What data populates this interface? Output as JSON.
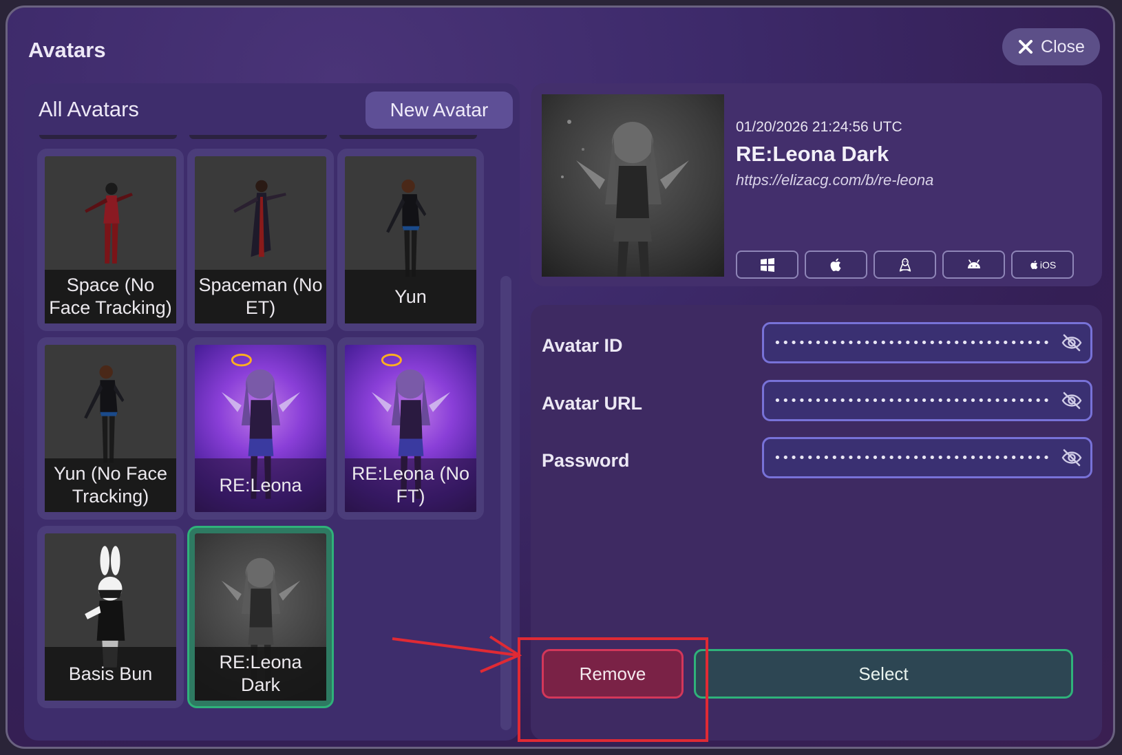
{
  "window": {
    "title": "Avatars",
    "close_label": "Close"
  },
  "left_panel": {
    "title": "All Avatars",
    "new_avatar_label": "New Avatar",
    "avatars": [
      {
        "name": "Space (No Face Tracking)",
        "style": "dark"
      },
      {
        "name": "Spaceman (No ET)",
        "style": "dark"
      },
      {
        "name": "Yun",
        "style": "dark"
      },
      {
        "name": "Yun (No Face Tracking)",
        "style": "dark"
      },
      {
        "name": "RE:Leona",
        "style": "purple"
      },
      {
        "name": "RE:Leona (No FT)",
        "style": "purple"
      },
      {
        "name": "Basis Bun",
        "style": "dark"
      },
      {
        "name": "RE:Leona Dark",
        "style": "gray",
        "selected": true
      }
    ]
  },
  "details": {
    "timestamp": "01/20/2026 21:24:56 UTC",
    "name": "RE:Leona Dark",
    "url": "https://elizacg.com/b/re-leona",
    "platforms": [
      {
        "icon": "windows-icon"
      },
      {
        "icon": "apple-icon"
      },
      {
        "icon": "linux-icon"
      },
      {
        "icon": "android-icon"
      },
      {
        "icon": "ios-icon",
        "label": "iOS"
      }
    ]
  },
  "form": {
    "avatar_id": {
      "label": "Avatar ID",
      "value": "••••••••••••••••••••••••••••••••••••••••"
    },
    "avatar_url": {
      "label": "Avatar URL",
      "value": "••••••••••••••••••••••••••••••••••••••••••..."
    },
    "password": {
      "label": "Password",
      "value": "••••••••••••••••••••••••••••••••••••••••••..."
    },
    "remove_label": "Remove",
    "select_label": "Select"
  },
  "colors": {
    "accent_green": "#2fb27a",
    "accent_red": "#d3375a",
    "annotation_red": "#e02a34",
    "field_border": "#7872d8"
  }
}
